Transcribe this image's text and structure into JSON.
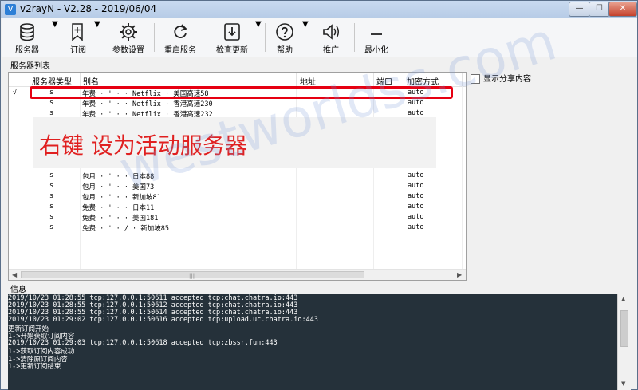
{
  "window": {
    "title": "v2rayN - V2.28 - 2019/06/04",
    "app_icon_glyph": "V",
    "min_glyph": "—",
    "max_glyph": "☐",
    "close_glyph": "✕"
  },
  "toolbar": {
    "servers": "服务器",
    "subscribe": "订阅",
    "settings": "参数设置",
    "restart": "重启服务",
    "check_update": "检查更新",
    "help": "帮助",
    "promote": "推广",
    "minimize": "最小化"
  },
  "server_list": {
    "section_label": "服务器列表",
    "columns": [
      "服务器类型",
      "别名",
      "地址",
      "端口",
      "加密方式"
    ],
    "rows": [
      {
        "active": "√",
        "type": "s",
        "alias": "年费 · '    · · Netflix · 美国高速58",
        "encryption": "auto"
      },
      {
        "active": "",
        "type": "s",
        "alias": "年费 · '    · · Netflix · 香港高速230",
        "encryption": "auto"
      },
      {
        "active": "",
        "type": "s",
        "alias": "年费 · '    · · Netflix · 香港高速232",
        "encryption": "auto"
      },
      {
        "active": "",
        "type": "s",
        "alias": "包月 · '    · · 日本88",
        "encryption": "auto"
      },
      {
        "active": "",
        "type": "s",
        "alias": "包月 · '    · · 美国73",
        "encryption": "auto"
      },
      {
        "active": "",
        "type": "s",
        "alias": "包月 · '    · · 新加坡81",
        "encryption": "auto"
      },
      {
        "active": "",
        "type": "s",
        "alias": "免费 · '    · · 日本11",
        "encryption": "auto"
      },
      {
        "active": "",
        "type": "s",
        "alias": "免费 · '    · · 美国181",
        "encryption": "auto"
      },
      {
        "active": "",
        "type": "s",
        "alias": "免费 · '    · / · 新加坡85",
        "encryption": "auto"
      }
    ],
    "callout": "右键 设为活动服务器"
  },
  "share_checkbox_label": "显示分享内容",
  "info": {
    "section_label": "信息",
    "log_lines": [
      "2019/10/23 01:28:55 tcp:127.0.0.1:50611 accepted tcp:chat.chatra.io:443",
      "2019/10/23 01:28:55 tcp:127.0.0.1:50612 accepted tcp:chat.chatra.io:443",
      "2019/10/23 01:28:55 tcp:127.0.0.1:50614 accepted tcp:chat.chatra.io:443",
      "2019/10/23 01:29:02 tcp:127.0.0.1:50616 accepted tcp:upload.uc.chatra.io:443",
      "更新订阅开始",
      "1->开始获取订阅内容",
      "2019/10/23 01:29:03 tcp:127.0.0.1:50618 accepted tcp:zbssr.fun:443",
      "1->获取订阅内容成功",
      "1->清除原订阅内容",
      "1->更新订阅结束"
    ]
  },
  "watermark": "westworldss.com",
  "colors": {
    "highlight": "#e60012",
    "callout": "#e02020",
    "log_bg": "#25313a"
  }
}
